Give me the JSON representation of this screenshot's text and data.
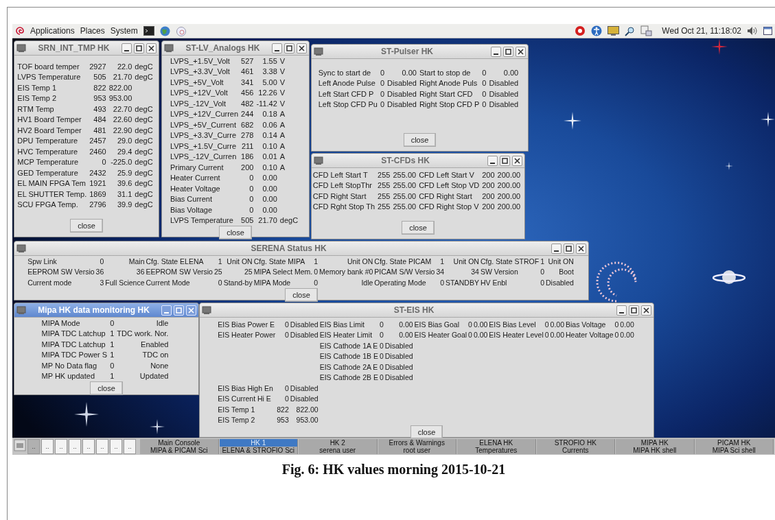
{
  "top_panel": {
    "menus": [
      "Applications",
      "Places",
      "System"
    ],
    "clock": "Wed Oct 21, 11:18:02"
  },
  "windows": [
    {
      "title": "SRN_INT_TMP HK",
      "active": false,
      "close": "close",
      "rows": [
        [
          [
            "TOF board temper",
            "2927",
            "22.0",
            "degC"
          ]
        ],
        [
          [
            "LVPS Temperature",
            "505",
            "21.70",
            "degC"
          ]
        ],
        [
          [
            "EIS Temp 1",
            "822",
            "822.00"
          ]
        ],
        [
          [
            "EIS Temp 2",
            "953",
            "953.00"
          ]
        ],
        [
          [
            "RTM Temp",
            "493",
            "22.70",
            "degC"
          ]
        ],
        [
          [
            "HV1 Board Temper",
            "484",
            "22.60",
            "degC"
          ]
        ],
        [
          [
            "HV2 Board Temper",
            "481",
            "22.90",
            "degC"
          ]
        ],
        [
          [
            "DPU Temperature",
            "2457",
            "29.0",
            "degC"
          ]
        ],
        [
          [
            "HVC Temperature",
            "2460",
            "29.4",
            "degC"
          ]
        ],
        [
          [
            "MCP Temperature",
            "0",
            "-225.0",
            "degC"
          ]
        ],
        [
          [
            "GED Temperature",
            "2432",
            "25.9",
            "degC"
          ]
        ],
        [
          [
            "EL MAIN FPGA Tem",
            "1921",
            "39.6",
            "degC"
          ]
        ],
        [
          [
            "EL SHUTTER Temp.",
            "1869",
            "31.1",
            "degC"
          ]
        ],
        [
          [
            "SCU FPGA Temp.",
            "2796",
            "39.9",
            "degC"
          ]
        ]
      ]
    },
    {
      "title": "ST-LV_Analogs HK",
      "active": false,
      "close": "close",
      "rows": [
        [
          [
            "LVPS_+1.5V_Volt",
            "527",
            "1.55",
            "V"
          ]
        ],
        [
          [
            "LVPS_+3.3V_Volt",
            "461",
            "3.38",
            "V"
          ]
        ],
        [
          [
            "LVPS_+5V_Volt",
            "341",
            "5.00",
            "V"
          ]
        ],
        [
          [
            "LVPS_+12V_Volt",
            "456",
            "12.26",
            "V"
          ]
        ],
        [
          [
            "LVPS_-12V_Volt",
            "482",
            "-11.42",
            "V"
          ]
        ],
        [
          [
            "LVPS_+12V_Curren",
            "244",
            "0.18",
            "A"
          ]
        ],
        [
          [
            "LVPS_+5V_Current",
            "682",
            "0.06",
            "A"
          ]
        ],
        [
          [
            "LVPS_+3.3V_Curre",
            "278",
            "0.14",
            "A"
          ]
        ],
        [
          [
            "LVPS_+1.5V_Curre",
            "211",
            "0.10",
            "A"
          ]
        ],
        [
          [
            "LVPS_-12V_Curren",
            "186",
            "0.01",
            "A"
          ]
        ],
        [
          [
            "Primary Current",
            "200",
            "0.10",
            "A"
          ]
        ],
        [
          [
            "Heater Current",
            "0",
            "0.00"
          ]
        ],
        [
          [
            "Heater Voltage",
            "0",
            "0.00"
          ]
        ],
        [
          [
            "Bias Current",
            "0",
            "0.00"
          ]
        ],
        [
          [
            "Bias Voltage",
            "0",
            "0.00"
          ]
        ],
        [
          [
            "LVPS Temperature",
            "505",
            "21.70",
            "degC"
          ]
        ]
      ]
    },
    {
      "title": "ST-Pulser HK",
      "active": false,
      "close": "close",
      "rows": [
        [
          [
            "Sync to start de",
            "0",
            "0.00"
          ],
          [
            "Start to stop de",
            "0",
            "0.00"
          ]
        ],
        [
          [
            "Left Anode Pulse",
            "0",
            "Disabled"
          ],
          [
            "Right Anode Puls",
            "0",
            "Disabled"
          ]
        ],
        [
          [
            "Left Start CFD P",
            "0",
            "Disabled"
          ],
          [
            "Right Start CFD",
            "0",
            "Disabled"
          ]
        ],
        [
          [
            "Left Stop CFD Pu",
            "0",
            "Disabled"
          ],
          [
            "Right Stop CFD P",
            "0",
            "Disabled"
          ]
        ]
      ]
    },
    {
      "title": "ST-CFDs HK",
      "active": false,
      "close": "close",
      "rows": [
        [
          [
            "CFD Left Start T",
            "255",
            "255.00"
          ],
          [
            "CFD Left Start V",
            "200",
            "200.00"
          ]
        ],
        [
          [
            "CFD Left StopThr",
            "255",
            "255.00"
          ],
          [
            "CFD Left Stop VD",
            "200",
            "200.00"
          ]
        ],
        [
          [
            "CFD Right Start",
            "255",
            "255.00"
          ],
          [
            "CFD Right Start",
            "200",
            "200.00"
          ]
        ],
        [
          [
            "CFD Rght Stop Th",
            "255",
            "255.00"
          ],
          [
            "CFD Right Stop V",
            "200",
            "200.00"
          ]
        ]
      ]
    },
    {
      "title": "SERENA Status HK",
      "active": false,
      "close": "close",
      "rows": [
        [
          [
            "Spw Link",
            "0",
            "Main"
          ],
          [
            "Cfg. State ELENA",
            "1",
            "Unit ON"
          ],
          [
            "Cfg. State MIPA",
            "1",
            "Unit ON"
          ],
          [
            "Cfg. State PICAM",
            "1",
            "Unit ON"
          ],
          [
            "Cfg. State STROF",
            "1",
            "Unit ON"
          ]
        ],
        [
          [
            "EEPROM SW Versio",
            "36",
            "36"
          ],
          [
            "EEPROM SW Versio",
            "25",
            "25"
          ],
          [
            "MIPA Select Mem.",
            "0",
            "Memory bank #0"
          ],
          [
            "PICAM S/W Versio",
            "34",
            "34"
          ],
          [
            "SW Version",
            "0",
            "Boot"
          ]
        ],
        [
          [
            "Current mode",
            "3",
            "Full Science"
          ],
          [
            "Current Mode",
            "0",
            "Stand-by"
          ],
          [
            "MIPA Mode",
            "0",
            "Idle"
          ],
          [
            "Operating Mode",
            "0",
            "STANDBY"
          ],
          [
            "HV Enbl",
            "0",
            "Disabled"
          ]
        ]
      ]
    },
    {
      "title": "Mipa HK data monitoring HK",
      "active": true,
      "close": "close",
      "rows": [
        [
          [
            "MIPA Mode",
            "0",
            "Idle"
          ]
        ],
        [
          [
            "MIPA TDC Latchup",
            "1",
            "TDC work. Nor."
          ]
        ],
        [
          [
            "MIPA TDC Latchup",
            "1",
            "Enabled"
          ]
        ],
        [
          [
            "MIPA TDC Power S",
            "1",
            "TDC on"
          ]
        ],
        [
          [
            "MP No Data flag",
            "0",
            "None"
          ]
        ],
        [
          [
            "MP HK updated",
            "1",
            "Updated"
          ]
        ]
      ]
    },
    {
      "title": "ST-EIS HK",
      "active": false,
      "close": "close",
      "rows": [
        [
          [
            "EIS Bias Power E",
            "0",
            "Disabled"
          ],
          [
            "EIS Bias Limit",
            "0",
            "0.00"
          ],
          [
            "EIS Bias Goal",
            "0",
            "0.00"
          ],
          [
            "EIS Bias Level",
            "0",
            "0.00"
          ],
          [
            "Bias Voltage",
            "0",
            "0.00"
          ]
        ],
        [
          [
            "EIS Heater Power",
            "0",
            "Disabled"
          ],
          [
            "EIS Heater Limit",
            "0",
            "0.00"
          ],
          [
            "EIS Heater Goal",
            "0",
            "0.00"
          ],
          [
            "EIS Heater Level",
            "0",
            "0.00"
          ],
          [
            "Heater Voltage",
            "0",
            "0.00"
          ]
        ],
        [
          null,
          [
            "EIS Cathode 1A E",
            "0",
            "Disabled"
          ]
        ],
        [
          null,
          [
            "EIS Cathode 1B E",
            "0",
            "Disabled"
          ]
        ],
        [
          null,
          [
            "EIS Cathode 2A E",
            "0",
            "Disabled"
          ]
        ],
        [
          null,
          [
            "EIS Cathode 2B E",
            "0",
            "Disabled"
          ]
        ],
        [
          [
            "EIS Bias High En",
            "0",
            "Disabled"
          ]
        ],
        [
          [
            "EIS Current Hi E",
            "0",
            "Disabled"
          ]
        ],
        [
          [
            "EIS Temp 1",
            "822",
            "822.00"
          ]
        ],
        [
          [
            "EIS Temp 2",
            "953",
            "953.00"
          ]
        ]
      ]
    }
  ],
  "taskbar": {
    "workspaces": [
      {
        "label": "..",
        "selected": true
      },
      {
        "label": "..",
        "selected": false
      },
      {
        "label": "..",
        "selected": false
      },
      {
        "label": "..",
        "selected": false
      },
      {
        "label": "..",
        "selected": false
      },
      {
        "label": "..",
        "selected": false
      },
      {
        "label": "..",
        "selected": false
      },
      {
        "label": "..",
        "selected": false
      }
    ],
    "tabs_top": [
      {
        "label": "Main Console",
        "selected": false
      },
      {
        "label": "HK 1",
        "selected": true
      },
      {
        "label": "HK 2",
        "selected": false
      },
      {
        "label": "Errors & Warnings",
        "selected": false
      },
      {
        "label": "ELENA HK",
        "selected": false
      },
      {
        "label": "STROFIO HK",
        "selected": false
      },
      {
        "label": "MIPA HK",
        "selected": false
      },
      {
        "label": "PICAM HK",
        "selected": false
      }
    ],
    "tabs_bottom": [
      {
        "label": "MIPA & PICAM Sci",
        "selected": false
      },
      {
        "label": "ELENA & STROFIO Sci",
        "selected": false
      },
      {
        "label": "serena user",
        "selected": false
      },
      {
        "label": "root user",
        "selected": false
      },
      {
        "label": "Temperatures",
        "selected": false
      },
      {
        "label": "Currents",
        "selected": false
      },
      {
        "label": "MIPA HK shell",
        "selected": false
      },
      {
        "label": "MIPA Sci shell",
        "selected": false
      }
    ]
  },
  "caption": "Fig. 6: HK values morning 2015-10-21"
}
